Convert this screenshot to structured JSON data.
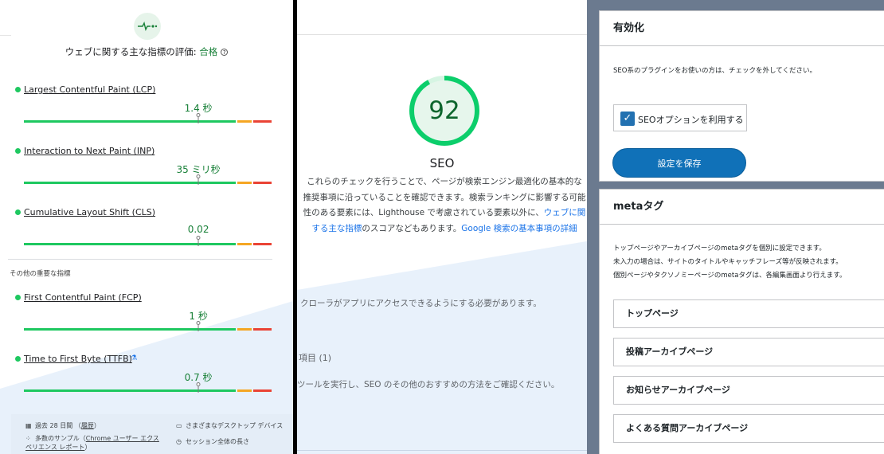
{
  "cwv": {
    "assessment_prefix": "ウェブに関する主な指標の評価: ",
    "assessment_result": "合格",
    "help_glyph": "?",
    "metrics": [
      {
        "name": "Largest Contentful Paint (LCP)",
        "value": "1.4 秒",
        "marker_fraction": 0.7
      },
      {
        "name": "Interaction to Next Paint (INP)",
        "value": "35 ミリ秒",
        "marker_fraction": 0.7
      },
      {
        "name": "Cumulative Layout Shift (CLS)",
        "value": "0.02",
        "marker_fraction": 0.7
      }
    ],
    "other_heading": "その他の重要な指標",
    "other_metrics": [
      {
        "name": "First Contentful Paint (FCP)",
        "value": "1 秒",
        "marker_fraction": 0.7
      },
      {
        "name": "Time to First Byte (TTFB)",
        "value": "0.7 秒",
        "marker_fraction": 0.7
      }
    ],
    "ttfb_icon_glyph": "⚗",
    "footer": {
      "period": "過去 28 日間",
      "history_link": "履歴",
      "devices": "さまざまなデスクトップ デバイス",
      "samples_prefix": "多数のサンプル（",
      "samples_link": "Chrome ユーザー エクスペリエンス レポート",
      "samples_suffix": "）",
      "session": "セッション全体の長さ"
    },
    "colors": {
      "good": "#1ec860",
      "ni": "#f5a623",
      "poor": "#ea4335"
    }
  },
  "seo": {
    "score": "92",
    "score_fraction": 0.92,
    "title": "SEO",
    "desc_part1": "これらのチェックを行うことで、ページが検索エンジン最適化の基本的な推奨事項に沿っていることを確認できます。検索ランキングに影響する可能性のある要素には、Lighthouse で考慮されている要素以外に、",
    "desc_link1": "ウェブに関する主な指標",
    "desc_part2": "のスコアなどもあります。",
    "desc_link2": "Google 検索の基本事項の詳細",
    "crawl_note": "クローラがアプリにアクセスできるようにする必要があります。",
    "items_label": "項目 (1)",
    "tool_note": "ツールを実行し、SEO のその他のおすすめの方法をご確認ください。",
    "colors": {
      "ring": "#0cce6b",
      "track": "#d6f5e3",
      "fill": "#e6f6ec"
    }
  },
  "settings": {
    "enable_box": {
      "title": "有効化",
      "note": "SEO系のプラグインをお使いの方は、チェックを外してください。",
      "checkbox_label": "SEOオプションを利用する",
      "checkbox_checked": true,
      "save_button": "設定を保存"
    },
    "meta_box": {
      "title": "metaタグ",
      "note_lines": [
        "トップページやアーカイブページのmetaタグを個別に設定できます。",
        "未入力の場合は、サイトのタイトルやキャッチフレーズ等が反映されます。",
        "個別ページやタクソノミーページのmetaタグは、各編集画面より行えます。"
      ],
      "sections": [
        "トップページ",
        "投稿アーカイブページ",
        "お知らせアーカイブページ",
        "よくある質問アーカイブページ"
      ]
    }
  }
}
